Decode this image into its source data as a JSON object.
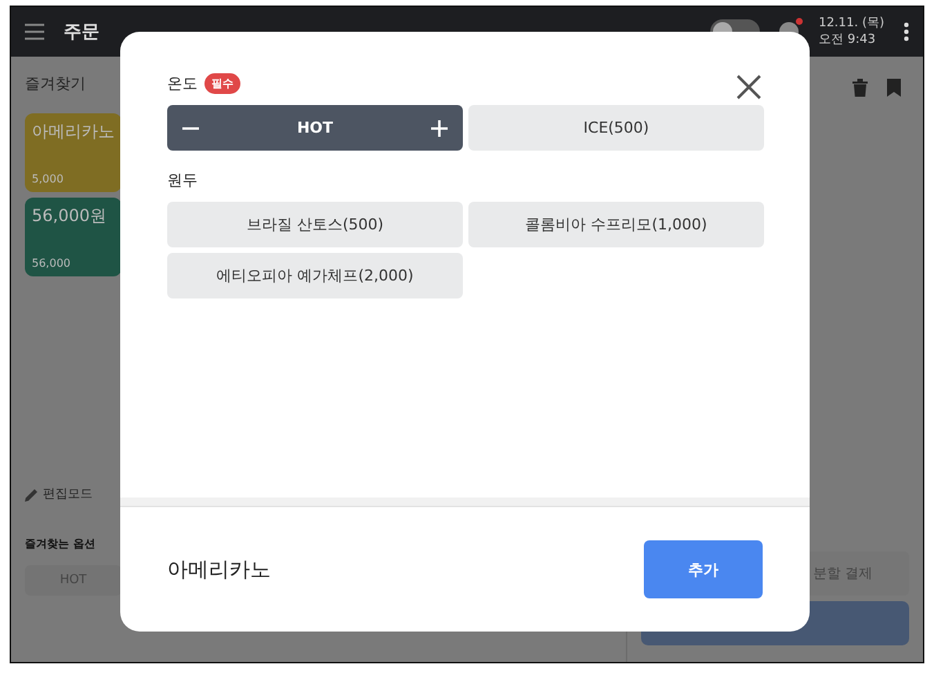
{
  "top_bar": {
    "tabs": [
      {
        "label": "주문",
        "selected": true
      }
    ],
    "toggle_on": false,
    "date": "12.11. (목)",
    "time": "오전 9:43"
  },
  "favorites": {
    "tab": "즐겨찾기",
    "items": [
      {
        "name": "아메리카노",
        "price": "5,000",
        "color": "#7f6d23"
      },
      {
        "name": "56,000원",
        "price": "56,000",
        "color": "#1f5445"
      }
    ],
    "edit_mode": "편집모드",
    "options_title": "즐겨찾는 옵션",
    "option_chip": "HOT"
  },
  "payment": {
    "split_button": "분할 결제"
  },
  "modal": {
    "groups": [
      {
        "title": "온도",
        "required_badge": "필수",
        "options": [
          {
            "label": "HOT",
            "selected": true
          },
          {
            "label": "ICE(500)",
            "selected": false
          }
        ]
      },
      {
        "title": "원두",
        "options": [
          {
            "label": "브라질 산토스(500)",
            "selected": false
          },
          {
            "label": "콜롬비아 수프리모(1,000)",
            "selected": false
          },
          {
            "label": "에티오피아 예가체프(2,000)",
            "selected": false
          }
        ]
      }
    ],
    "product_name": "아메리카노",
    "add_button": "추가"
  }
}
